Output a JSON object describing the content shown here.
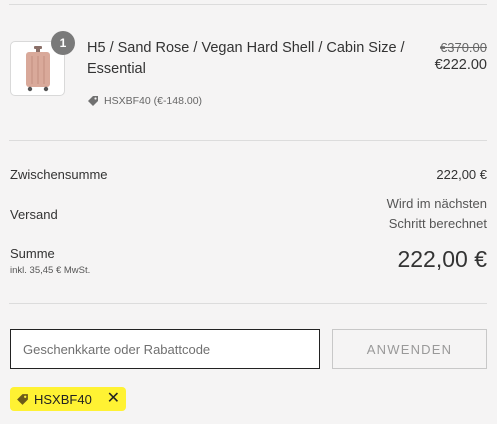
{
  "item": {
    "quantity": "1",
    "title": "H5 / Sand Rose / Vegan Hard Shell / Cabin Size / Essential",
    "original_price": "€370.00",
    "price": "€222.00",
    "discount_tag": "HSXBF40 (€-148.00)",
    "thumbnail_icon": "suitcase-icon",
    "suitcase_color": "#d9a99a"
  },
  "summary": {
    "subtotal_label": "Zwischensumme",
    "subtotal_value": "222,00 €",
    "shipping_label": "Versand",
    "shipping_value_line1": "Wird im nächsten",
    "shipping_value_line2": "Schritt berechnet",
    "total_label": "Summe",
    "tax_note": "inkl. 35,45 € MwSt.",
    "total_value": "222,00 €"
  },
  "discount_form": {
    "placeholder": "Geschenkkarte oder Rabattcode",
    "apply_label": "ANWENDEN",
    "applied_code": "HSXBF40",
    "remove_symbol": "✕",
    "highlight_color": "#fff233"
  }
}
